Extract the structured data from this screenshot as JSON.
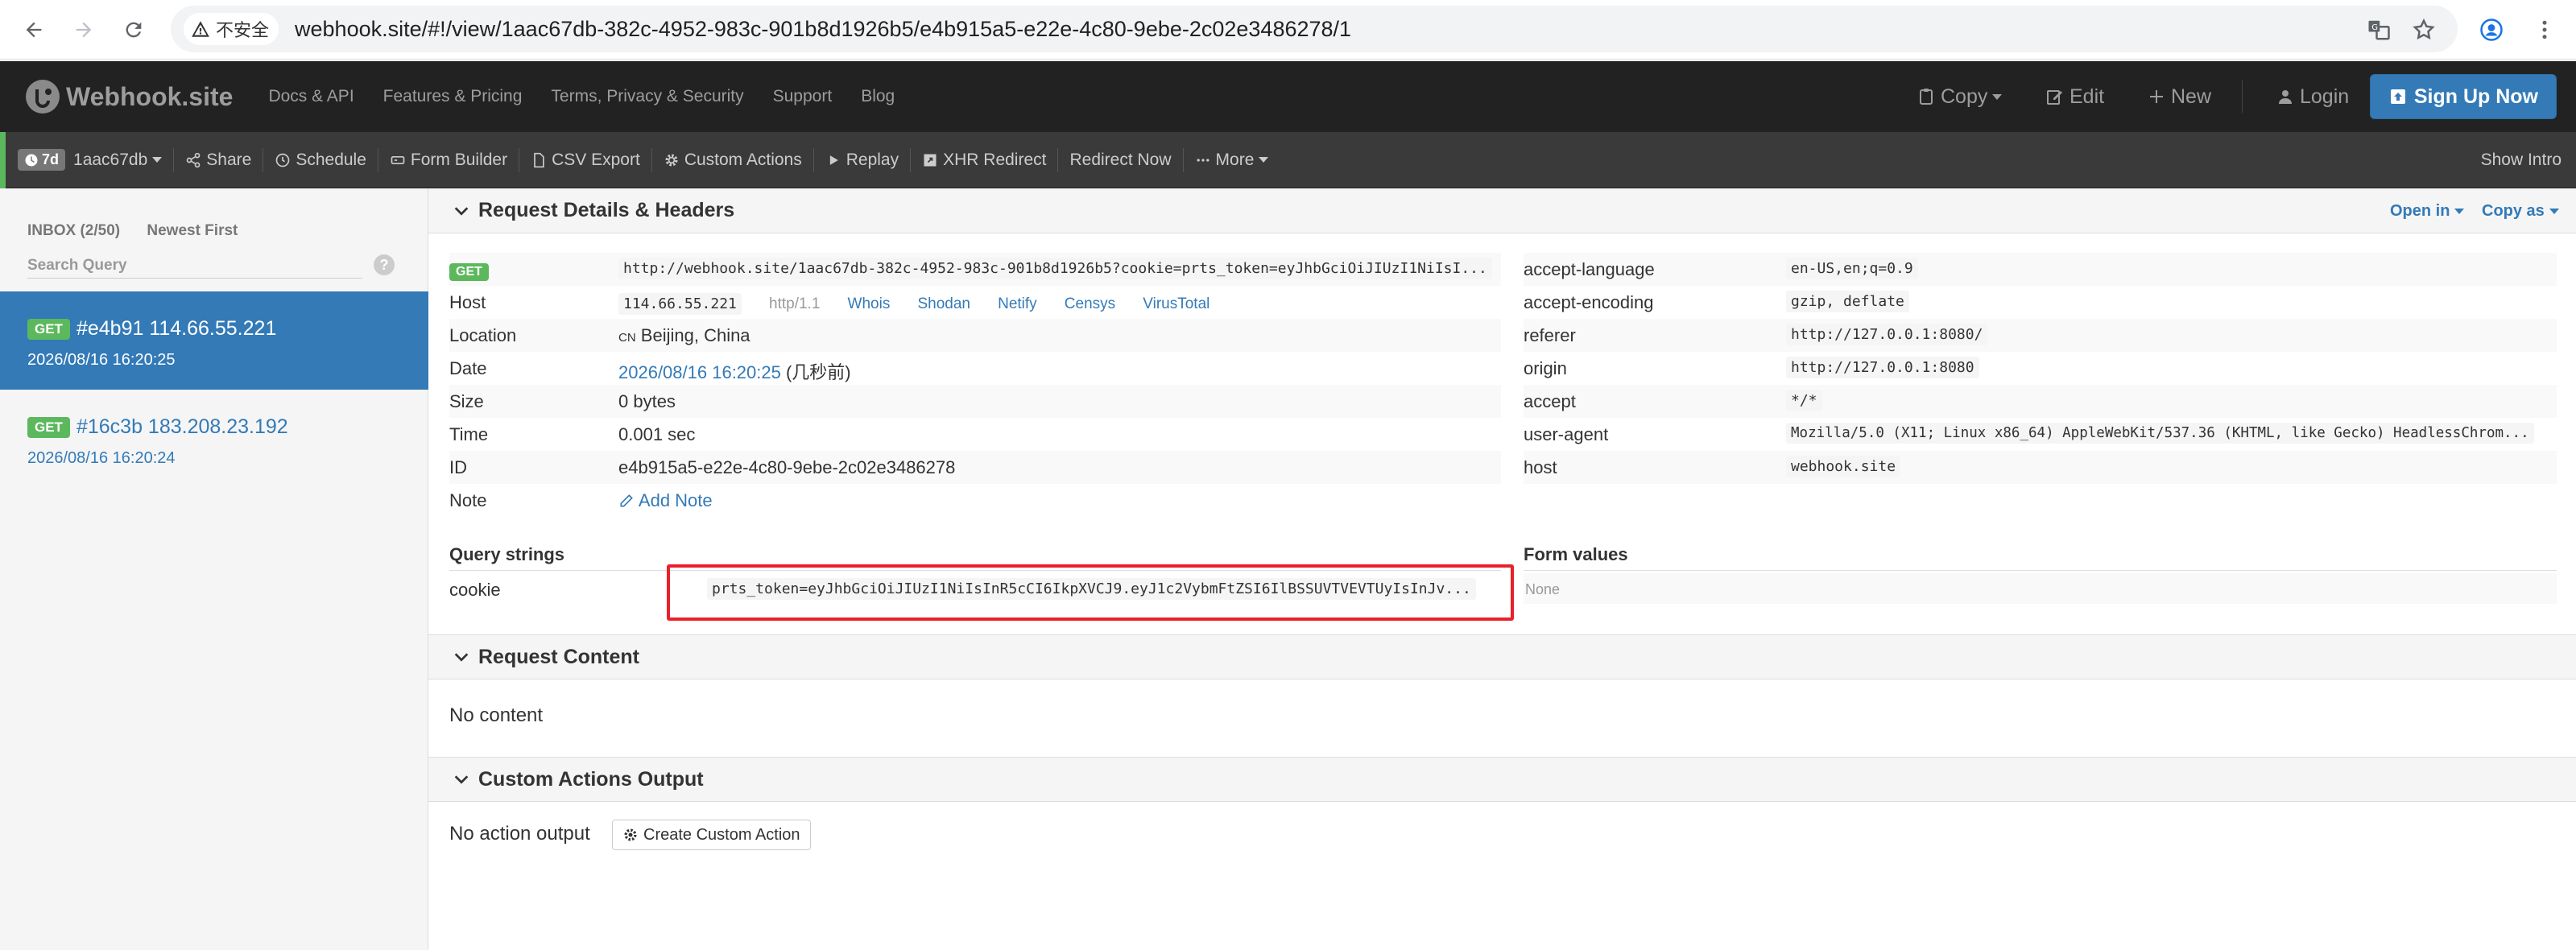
{
  "browser": {
    "insecure_label": "不安全",
    "url": "webhook.site/#!/view/1aac67db-382c-4952-983c-901b8d1926b5/e4b915a5-e22e-4c80-9ebe-2c02e3486278/1"
  },
  "navbar": {
    "brand": "Webhook.site",
    "links": [
      "Docs & API",
      "Features & Pricing",
      "Terms, Privacy & Security",
      "Support",
      "Blog"
    ],
    "copy": "Copy",
    "edit": "Edit",
    "new": "New",
    "login": "Login",
    "signup": "Sign Up Now"
  },
  "toolbar": {
    "ttl": "7d",
    "token": "1aac67db",
    "share": "Share",
    "schedule": "Schedule",
    "form_builder": "Form Builder",
    "csv_export": "CSV Export",
    "custom_actions": "Custom Actions",
    "replay": "Replay",
    "xhr_redirect": "XHR Redirect",
    "redirect_now": "Redirect Now",
    "more": "More",
    "show_intro": "Show Intro"
  },
  "sidebar": {
    "inbox": "INBOX (2/50)",
    "sort": "Newest First",
    "search_placeholder": "Search Query",
    "help": "?",
    "requests": [
      {
        "method": "GET",
        "title": "#e4b91 114.66.55.221",
        "time": "2026/08/16 16:20:25"
      },
      {
        "method": "GET",
        "title": "#16c3b 183.208.23.192",
        "time": "2026/08/16 16:20:24"
      }
    ]
  },
  "details": {
    "header": "Request Details & Headers",
    "open_in": "Open in",
    "copy_as": "Copy as",
    "method": "GET",
    "request_url": "http://webhook.site/1aac67db-382c-4952-983c-901b8d1926b5?cookie=prts_token=eyJhbGciOiJIUzI1NiIsI...",
    "host_label": "Host",
    "host_ip": "114.66.55.221",
    "http_version": "http/1.1",
    "host_links": [
      "Whois",
      "Shodan",
      "Netify",
      "Censys",
      "VirusTotal"
    ],
    "location_label": "Location",
    "location_flag": "CN",
    "location": "Beijing, China",
    "date_label": "Date",
    "date": "2026/08/16 16:20:25",
    "date_relative": "(几秒前)",
    "size_label": "Size",
    "size": "0 bytes",
    "time_label": "Time",
    "time": "0.001 sec",
    "id_label": "ID",
    "id": "e4b915a5-e22e-4c80-9ebe-2c02e3486278",
    "note_label": "Note",
    "add_note": "Add Note",
    "headers": [
      {
        "key": "accept-language",
        "value": "en-US,en;q=0.9"
      },
      {
        "key": "accept-encoding",
        "value": "gzip, deflate"
      },
      {
        "key": "referer",
        "value": "http://127.0.0.1:8080/"
      },
      {
        "key": "origin",
        "value": "http://127.0.0.1:8080"
      },
      {
        "key": "accept",
        "value": "*/*"
      },
      {
        "key": "user-agent",
        "value": "Mozilla/5.0 (X11; Linux x86_64) AppleWebKit/537.36 (KHTML, like Gecko) HeadlessChrom..."
      },
      {
        "key": "host",
        "value": "webhook.site"
      }
    ],
    "query_strings_label": "Query strings",
    "query_key": "cookie",
    "query_value": "prts_token=eyJhbGciOiJIUzI1NiIsInR5cCI6IkpXVCJ9.eyJ1c2VybmFtZSI6IlBSSUVTVEVTUyIsInJv...",
    "form_values_label": "Form values",
    "form_values": "None"
  },
  "content": {
    "header": "Request Content",
    "body": "No content"
  },
  "actions": {
    "header": "Custom Actions Output",
    "body": "No action output",
    "create": "Create Custom Action"
  },
  "colors": {
    "navbar": "#222222",
    "toolbar": "#3a3a3a",
    "active_request": "#337ab7",
    "get_badge": "#5cb85c",
    "highlight_box": "#e8212b",
    "signup": "#337ab7"
  }
}
